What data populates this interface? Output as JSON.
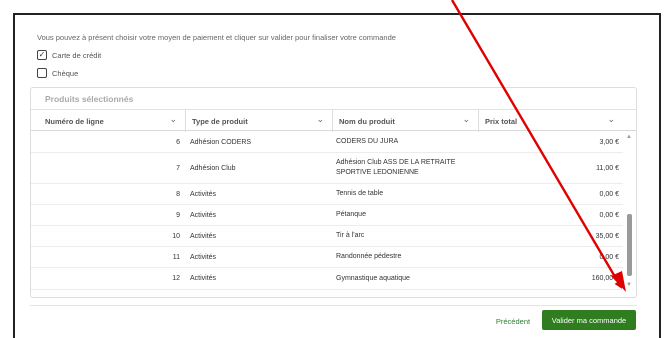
{
  "intro_text": "Vous pouvez à présent choisir votre moyen de paiement et cliquer sur valider pour finaliser votre commande",
  "payment_options": [
    {
      "label": "Carte de crédit",
      "checked": true
    },
    {
      "label": "Chèque",
      "checked": false
    }
  ],
  "panel_title": "Produits sélectionnés",
  "columns": [
    "Numéro de ligne",
    "Type de produit",
    "Nom du produit",
    "Prix total"
  ],
  "rows": [
    {
      "num": "6",
      "type": "Adhésion CODERS",
      "nom": "CODERS DU JURA",
      "prix": "3,00 €"
    },
    {
      "num": "7",
      "type": "Adhésion Club",
      "nom": "Adhésion Club ASS DE LA RETRAITE SPORTIVE LEDONIENNE",
      "prix": "11,00 €"
    },
    {
      "num": "8",
      "type": "Activités",
      "nom": "Tennis de table",
      "prix": "0,00 €"
    },
    {
      "num": "9",
      "type": "Activités",
      "nom": "Pétanque",
      "prix": "0,00 €"
    },
    {
      "num": "10",
      "type": "Activités",
      "nom": "Tir à l'arc",
      "prix": "35,00 €"
    },
    {
      "num": "11",
      "type": "Activités",
      "nom": "Randonnée pédestre",
      "prix": "0,00 €"
    },
    {
      "num": "12",
      "type": "Activités",
      "nom": "Gymnastique aquatique",
      "prix": "160,00 €"
    }
  ],
  "buttons": {
    "previous": "Précédent",
    "validate": "Valider ma commande"
  },
  "colors": {
    "primary_green": "#2f7d1f",
    "annotation_red": "#e00000"
  }
}
